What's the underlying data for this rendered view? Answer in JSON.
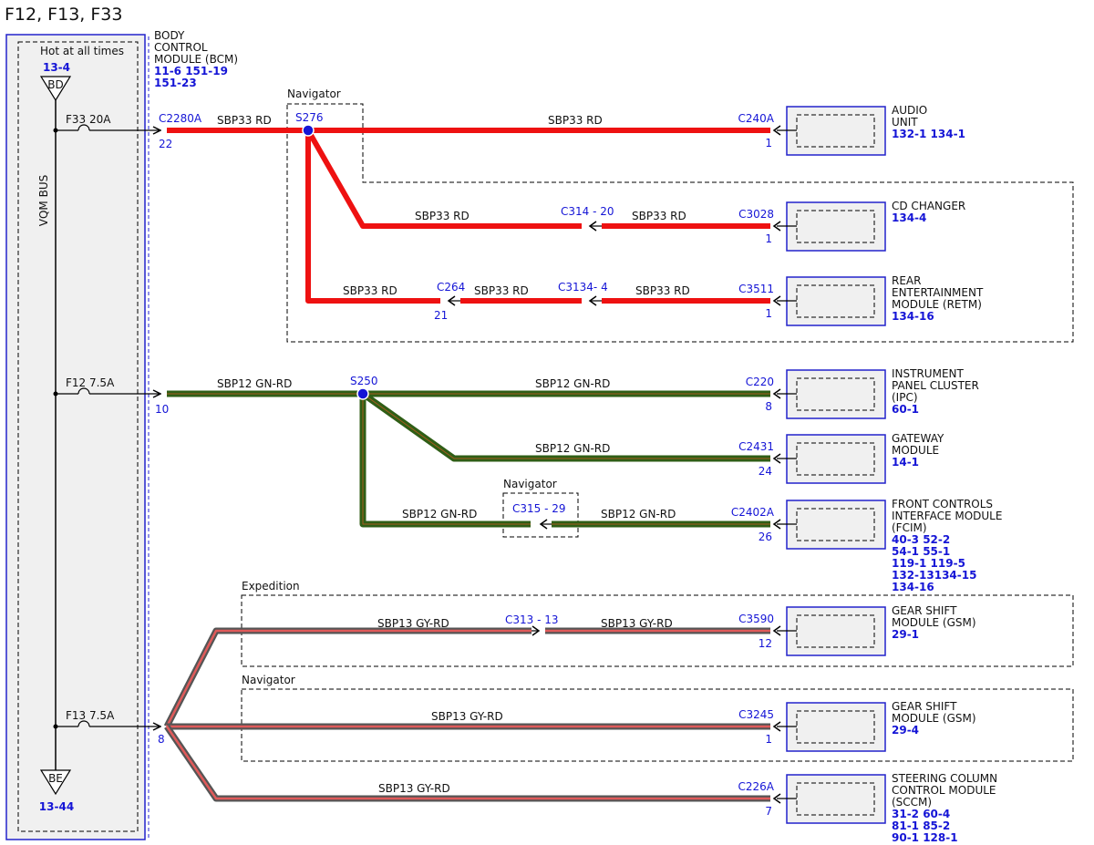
{
  "title": "F12, F13, F33",
  "bcm": {
    "label_lines": [
      "BODY",
      "CONTROL",
      "MODULE (BCM)"
    ],
    "ref_lines": [
      "11-6  151-19",
      "151-23"
    ]
  },
  "fusebox": {
    "hot_label": "Hot at all times",
    "top_ref": "13-4",
    "top_tag": "BD",
    "bus_label": "VQM BUS",
    "bottom_tag": "BE",
    "bottom_ref": "13-44"
  },
  "fuses": [
    {
      "label": "F33  20A"
    },
    {
      "label": "F12  7.5A"
    },
    {
      "label": "F13  7.5A"
    }
  ],
  "bcm_pins": {
    "c2280a": "C2280A",
    "p22": "22",
    "p10": "10",
    "p8": "8"
  },
  "regions": {
    "nav1": "Navigator",
    "nav2": "Navigator",
    "expedition": "Expedition",
    "nav3": "Navigator"
  },
  "splices": {
    "s276": "S276",
    "s250": "S250"
  },
  "wires": {
    "sbp33": "SBP33  RD",
    "sbp12": "SBP12  GN-RD",
    "sbp13": "SBP13  GY-RD"
  },
  "inline_connectors": {
    "c314": "C314 - 20",
    "c264": "C264",
    "c264_pin": "21",
    "c3134": "C3134- 4",
    "c315": "C315 - 29",
    "c313": "C313 - 13"
  },
  "modules": [
    {
      "connector": "C240A",
      "pin": "1",
      "name_lines": [
        "AUDIO",
        "UNIT"
      ],
      "ref_lines": [
        "132-1 134-1"
      ]
    },
    {
      "connector": "C3028",
      "pin": "1",
      "name_lines": [
        "CD CHANGER"
      ],
      "ref_lines": [
        "134-4"
      ]
    },
    {
      "connector": "C3511",
      "pin": "1",
      "name_lines": [
        "REAR",
        "ENTERTAINMENT",
        "MODULE (RETM)"
      ],
      "ref_lines": [
        "134-16"
      ]
    },
    {
      "connector": "C220",
      "pin": "8",
      "name_lines": [
        "INSTRUMENT",
        "PANEL CLUSTER",
        "(IPC)"
      ],
      "ref_lines": [
        "60-1"
      ]
    },
    {
      "connector": "C2431",
      "pin": "24",
      "name_lines": [
        "GATEWAY",
        "MODULE"
      ],
      "ref_lines": [
        "14-1"
      ]
    },
    {
      "connector": "C2402A",
      "pin": "26",
      "name_lines": [
        "FRONT CONTROLS",
        "INTERFACE MODULE",
        "(FCIM)"
      ],
      "ref_lines": [
        "40-3  52-2",
        "54-1  55-1",
        "119-1 119-5",
        "132-13134-15",
        "134-16"
      ]
    },
    {
      "connector": "C3590",
      "pin": "12",
      "name_lines": [
        "GEAR SHIFT",
        "MODULE (GSM)"
      ],
      "ref_lines": [
        "29-1"
      ]
    },
    {
      "connector": "C3245",
      "pin": "1",
      "name_lines": [
        "GEAR SHIFT",
        "MODULE (GSM)"
      ],
      "ref_lines": [
        "29-4"
      ]
    },
    {
      "connector": "C226A",
      "pin": "7",
      "name_lines": [
        "STEERING COLUMN",
        "CONTROL MODULE",
        "(SCCM)"
      ],
      "ref_lines": [
        "31-2  60-4",
        "81-1  85-2",
        "90-1  128-1"
      ]
    }
  ],
  "colors": {
    "rd": "#ee1111",
    "gn": "#2f5e16",
    "gy_outer": "#555555",
    "gy_inner": "#e05a5a",
    "blue": "#1515d6",
    "box": "#f0f0f0"
  }
}
